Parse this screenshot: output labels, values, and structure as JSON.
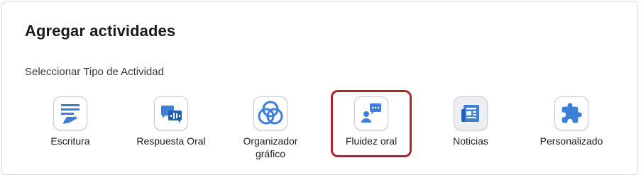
{
  "header": {
    "title": "Agregar actividades"
  },
  "section": {
    "label": "Seleccionar Tipo de Actividad"
  },
  "activities": [
    {
      "label": "Escritura",
      "icon": "writing-icon"
    },
    {
      "label": "Respuesta Oral",
      "icon": "voice-response-icon"
    },
    {
      "label": "Organizador gráfico",
      "icon": "venn-diagram-icon"
    },
    {
      "label": "Fluidez oral",
      "icon": "speaking-person-icon",
      "selected": true
    },
    {
      "label": "Noticias",
      "icon": "newspaper-icon"
    },
    {
      "label": "Personalizado",
      "icon": "puzzle-piece-icon"
    }
  ],
  "colors": {
    "accent": "#3b7fd9",
    "selected_border": "#b3232d"
  }
}
